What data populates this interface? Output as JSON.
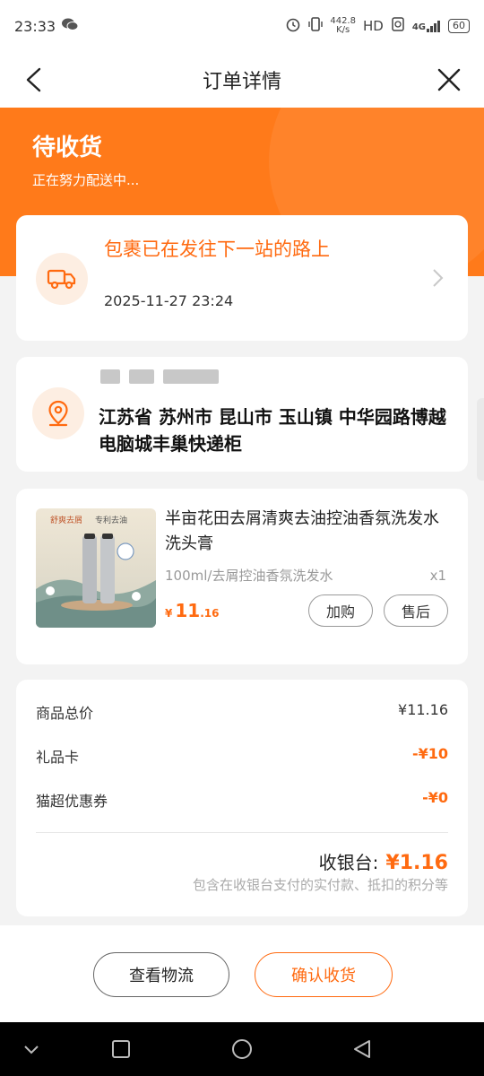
{
  "status_bar": {
    "time": "23:33",
    "net_speed_value": "442.8",
    "net_speed_unit": "K/s",
    "network_label": "HD",
    "signal_label": "4G",
    "battery": "60"
  },
  "nav": {
    "title": "订单详情"
  },
  "hero": {
    "status": "待收货",
    "subtitle": "正在努力配送中..."
  },
  "logistics": {
    "title": "包裹已在发往下一站的路上",
    "time": "2025-11-27 23:24"
  },
  "address": {
    "full_address": "江苏省 苏州市 昆山市 玉山镇 中华园路博越电脑城丰巢快递柜"
  },
  "product": {
    "title": "半亩花田去屑清爽去油控油香氛洗发水洗头膏",
    "spec": "100ml/去屑控油香氛洗发水",
    "quantity": "x1",
    "price_symbol": "¥",
    "price_integer": "11",
    "price_decimal": ".16",
    "add_buy_label": "加购",
    "after_sale_label": "售后",
    "image_text_1": "舒爽去屑",
    "image_text_2": "专利去油"
  },
  "summary": {
    "rows": [
      {
        "label": "商品总价",
        "value": "¥11.16"
      },
      {
        "label": "礼品卡",
        "value": "-¥10"
      },
      {
        "label": "猫超优惠券",
        "value": "-¥0"
      }
    ],
    "total_label": "收银台:",
    "total_value": "¥1.16",
    "note": "包含在收银台支付的实付款、抵扣的积分等"
  },
  "actions": {
    "view_logistics": "查看物流",
    "confirm_receipt": "确认收货"
  },
  "colors": {
    "accent": "#ff6a10",
    "hero_bg": "#ff7a1a"
  }
}
